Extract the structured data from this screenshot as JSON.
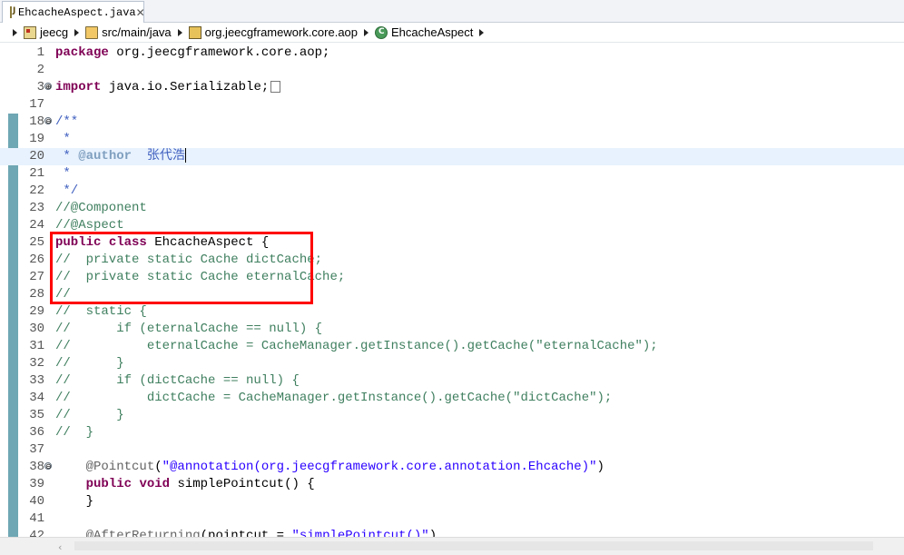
{
  "tab": {
    "title": "EhcacheAspect.java",
    "close": "✕"
  },
  "breadcrumb": [
    "jeecg",
    "src/main/java",
    "org.jeecgframework.core.aop",
    "EhcacheAspect"
  ],
  "editor": {
    "lines": [
      {
        "num": "1",
        "tokens": [
          {
            "t": "package",
            "c": "kw"
          },
          {
            "t": " org.jeecgframework.core.aop;"
          }
        ]
      },
      {
        "num": "2",
        "tokens": []
      },
      {
        "num": "3",
        "fold": "⊕",
        "tokens": [
          {
            "t": "import",
            "c": "kw"
          },
          {
            "t": " java.io.Serializable;"
          },
          {
            "t": "",
            "c": "boxmark"
          }
        ]
      },
      {
        "num": "17",
        "tokens": []
      },
      {
        "num": "18",
        "fold": "⊖",
        "tokens": [
          {
            "t": "/**",
            "c": "jd"
          }
        ]
      },
      {
        "num": "19",
        "tokens": [
          {
            "t": " *",
            "c": "jd"
          }
        ]
      },
      {
        "num": "20",
        "highlight": true,
        "tokens": [
          {
            "t": " * ",
            "c": "jd"
          },
          {
            "t": "@author",
            "c": "tag"
          },
          {
            "t": "  张代浩",
            "c": "jd"
          },
          {
            "t": "",
            "c": "caret"
          }
        ]
      },
      {
        "num": "21",
        "tokens": [
          {
            "t": " *",
            "c": "jd"
          }
        ]
      },
      {
        "num": "22",
        "tokens": [
          {
            "t": " */",
            "c": "jd"
          }
        ]
      },
      {
        "num": "23",
        "tokens": [
          {
            "t": "//@Component",
            "c": "cm"
          }
        ]
      },
      {
        "num": "24",
        "tokens": [
          {
            "t": "//@Aspect",
            "c": "cm"
          }
        ]
      },
      {
        "num": "25",
        "tokens": [
          {
            "t": "public",
            "c": "kw"
          },
          {
            "t": " "
          },
          {
            "t": "class",
            "c": "kw"
          },
          {
            "t": " EhcacheAspect {"
          }
        ]
      },
      {
        "num": "26",
        "tokens": [
          {
            "t": "//  private static Cache dictCache;",
            "c": "cm"
          }
        ]
      },
      {
        "num": "27",
        "tokens": [
          {
            "t": "//  private static Cache eternalCache;",
            "c": "cm"
          }
        ]
      },
      {
        "num": "28",
        "tokens": [
          {
            "t": "//",
            "c": "cm"
          }
        ]
      },
      {
        "num": "29",
        "tokens": [
          {
            "t": "//  static {",
            "c": "cm"
          }
        ]
      },
      {
        "num": "30",
        "tokens": [
          {
            "t": "//      if (eternalCache == null) {",
            "c": "cm"
          }
        ]
      },
      {
        "num": "31",
        "tokens": [
          {
            "t": "//          eternalCache = CacheManager.getInstance().getCache(\"eternalCache\");",
            "c": "cm"
          }
        ]
      },
      {
        "num": "32",
        "tokens": [
          {
            "t": "//      }",
            "c": "cm"
          }
        ]
      },
      {
        "num": "33",
        "tokens": [
          {
            "t": "//      if (dictCache == null) {",
            "c": "cm"
          }
        ]
      },
      {
        "num": "34",
        "tokens": [
          {
            "t": "//          dictCache = CacheManager.getInstance().getCache(\"dictCache\");",
            "c": "cm"
          }
        ]
      },
      {
        "num": "35",
        "tokens": [
          {
            "t": "//      }",
            "c": "cm"
          }
        ]
      },
      {
        "num": "36",
        "tokens": [
          {
            "t": "//  }",
            "c": "cm"
          }
        ]
      },
      {
        "num": "37",
        "tokens": []
      },
      {
        "num": "38",
        "fold": "⊖",
        "tokens": [
          {
            "t": "    @Pointcut",
            "c": "ann"
          },
          {
            "t": "("
          },
          {
            "t": "\"@annotation(org.jeecgframework.core.annotation.Ehcache)\"",
            "c": "str"
          },
          {
            "t": ")"
          }
        ]
      },
      {
        "num": "39",
        "tokens": [
          {
            "t": "    "
          },
          {
            "t": "public",
            "c": "kw"
          },
          {
            "t": " "
          },
          {
            "t": "void",
            "c": "kw"
          },
          {
            "t": " simplePointcut() {"
          }
        ]
      },
      {
        "num": "40",
        "tokens": [
          {
            "t": "    }"
          }
        ]
      },
      {
        "num": "41",
        "tokens": []
      },
      {
        "num": "42",
        "tokens": [
          {
            "t": "    @AfterReturning",
            "c": "ann"
          },
          {
            "t": "(pointcut = "
          },
          {
            "t": "\"simplePointcut()\"",
            "c": "str"
          },
          {
            "t": ")"
          }
        ]
      }
    ]
  }
}
